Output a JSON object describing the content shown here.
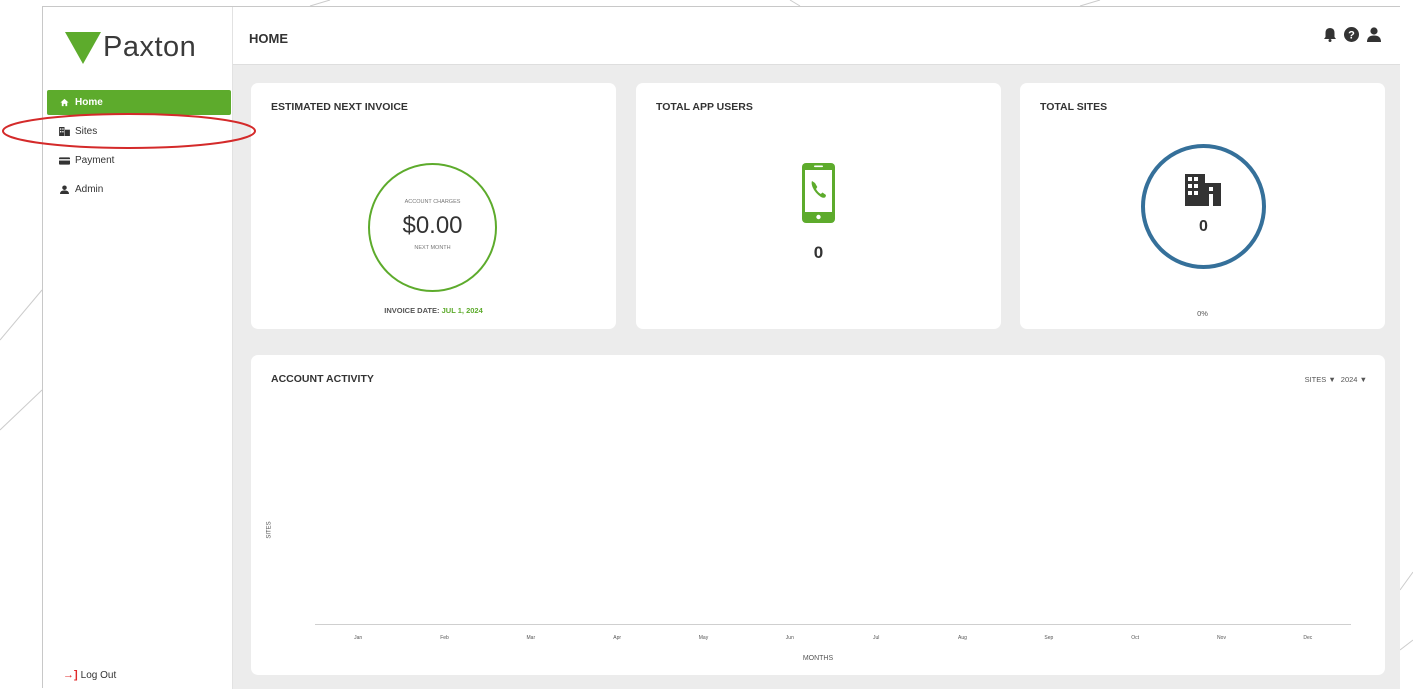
{
  "brand": {
    "name": "Paxton",
    "color": "#5dab2c"
  },
  "sidebar": {
    "items": [
      {
        "label": "Home",
        "icon": "home-icon",
        "active": true
      },
      {
        "label": "Sites",
        "icon": "building-icon",
        "active": false
      },
      {
        "label": "Payment",
        "icon": "credit-card-icon",
        "active": false
      },
      {
        "label": "Admin",
        "icon": "user-icon",
        "active": false
      }
    ],
    "logout_label": "Log Out"
  },
  "header": {
    "title": "HOME",
    "icons": [
      "bell-icon",
      "help-icon",
      "user-icon"
    ]
  },
  "cards": {
    "invoice": {
      "title": "ESTIMATED NEXT INVOICE",
      "top_label": "ACCOUNT CHARGES",
      "amount": "$0.00",
      "bottom_label": "NEXT MONTH",
      "date_label": "INVOICE DATE:",
      "date_value": "JUL 1, 2024"
    },
    "app_users": {
      "title": "TOTAL APP USERS",
      "count": "0",
      "icon": "phone-icon"
    },
    "sites": {
      "title": "TOTAL SITES",
      "count": "0",
      "percent": "0%",
      "icon": "building-icon"
    }
  },
  "activity": {
    "title": "ACCOUNT ACTIVITY",
    "filter_type": "SITES",
    "filter_year": "2024"
  },
  "chart_data": {
    "type": "line",
    "title": "ACCOUNT ACTIVITY",
    "xlabel": "MONTHS",
    "ylabel": "SITES",
    "categories": [
      "Jan",
      "Feb",
      "Mar",
      "Apr",
      "May",
      "Jun",
      "Jul",
      "Aug",
      "Sep",
      "Oct",
      "Nov",
      "Dec"
    ],
    "series": []
  },
  "colors": {
    "accent": "#5dab2c",
    "sites_ring": "#35709a",
    "annotation": "#d42a2a"
  }
}
